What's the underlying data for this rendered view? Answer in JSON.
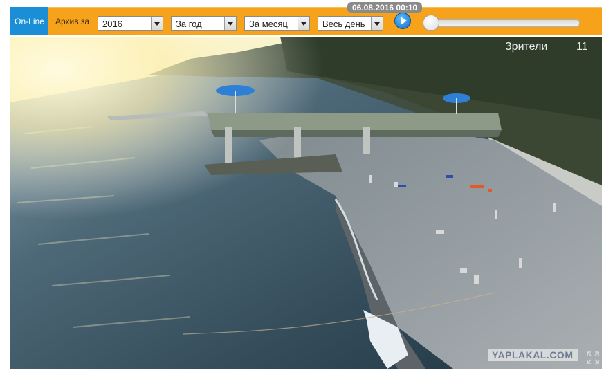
{
  "toolbar": {
    "online_tab": "On-Line",
    "archive_label": "Архив за",
    "year_select": "2016",
    "period_select": "За год",
    "month_select": "За месяц",
    "day_select": "Весь день",
    "timestamp": "06.08.2016 00:10",
    "playback_position": 0.0
  },
  "video": {
    "viewers_label": "Зрители",
    "viewers_count": "11",
    "watermark": "YAPLAKAL.COM",
    "scene": "beach-camera"
  },
  "colors": {
    "toolbar_bg": "#f7a21b",
    "online_tab_bg": "#1a8ed6",
    "timestamp_bg": "#8a8a8a"
  }
}
